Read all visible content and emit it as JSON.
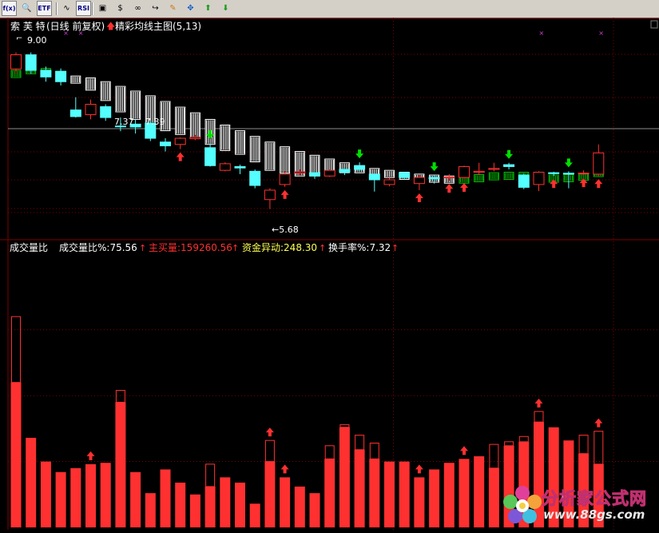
{
  "toolbar": {
    "buttons": [
      {
        "name": "formula-icon",
        "glyph": "f(x)"
      },
      {
        "name": "search-icon",
        "glyph": "🔍"
      },
      {
        "name": "etf-button",
        "glyph": "ETF"
      },
      {
        "name": "indicator-chart-icon",
        "glyph": "∿"
      },
      {
        "name": "rsi-button",
        "glyph": "RSI"
      },
      {
        "name": "picture-icon",
        "glyph": "▣"
      },
      {
        "name": "dollar-icon",
        "glyph": "$"
      },
      {
        "name": "link-icon",
        "glyph": "∞"
      },
      {
        "name": "export-icon",
        "glyph": "↪"
      },
      {
        "name": "pencil-icon",
        "glyph": "✎"
      },
      {
        "name": "move-icon",
        "glyph": "✥"
      },
      {
        "name": "up-arrow-icon",
        "glyph": "⬆"
      },
      {
        "name": "down-arrow-icon",
        "glyph": "⬇"
      }
    ]
  },
  "main_panel": {
    "stock_name": "索 芙 特",
    "period": "(日线 前复权)",
    "indicator_name": "精彩均线主图(5,13)",
    "high_label": "9.00",
    "low_label": "←5.68",
    "mid_label_a": "7.37",
    "mid_label_b": "7.39"
  },
  "sub_panel": {
    "name": "成交量比",
    "ratio_label": "成交量比%:75.56",
    "buy_label": "主买量:159260.56",
    "fund_label": "资金异动:248.30",
    "turnover_label": "换手率%:7.32"
  },
  "watermark": {
    "text": "分析家公式网",
    "url": "www.88gs.com"
  },
  "colors": {
    "up": "#ff3030",
    "down": "#54ffff",
    "ma_up": "#00c000",
    "ma_down": "#ffffff",
    "buy_arrow": "#ff3030",
    "sell_arrow": "#00e000",
    "label_white": "#ffffff",
    "label_yellow": "#ffff54",
    "label_red": "#ff3030",
    "grid": "#7f0000"
  },
  "chart_data": [
    {
      "type": "candlestick",
      "title": "精彩均线主图(5,13)",
      "ylim": [
        5.3,
        9.4
      ],
      "candles": [
        {
          "o": 8.65,
          "c": 8.95,
          "h": 9.0,
          "l": 8.55
        },
        {
          "o": 8.95,
          "c": 8.62,
          "h": 9.0,
          "l": 8.55
        },
        {
          "o": 8.62,
          "c": 8.48,
          "h": 8.7,
          "l": 8.38
        },
        {
          "o": 8.6,
          "c": 8.38,
          "h": 8.66,
          "l": 8.3
        },
        {
          "o": 7.78,
          "c": 7.64,
          "h": 8.05,
          "l": 7.62
        },
        {
          "o": 7.68,
          "c": 7.9,
          "h": 8.0,
          "l": 7.58
        },
        {
          "o": 7.85,
          "c": 7.62,
          "h": 7.9,
          "l": 7.55
        },
        {
          "o": 7.44,
          "c": 7.43,
          "h": 7.62,
          "l": 7.33
        },
        {
          "o": 7.48,
          "c": 7.42,
          "h": 7.58,
          "l": 7.28
        },
        {
          "o": 7.5,
          "c": 7.18,
          "h": 7.55,
          "l": 7.12
        },
        {
          "o": 7.1,
          "c": 7.02,
          "h": 7.18,
          "l": 6.9
        },
        {
          "o": 7.05,
          "c": 7.18,
          "h": 7.2,
          "l": 6.95
        },
        {
          "o": 7.17,
          "c": 7.2,
          "h": 7.25,
          "l": 7.14
        },
        {
          "o": 6.98,
          "c": 6.6,
          "h": 7.08,
          "l": 6.58
        },
        {
          "o": 6.5,
          "c": 6.64,
          "h": 6.67,
          "l": 6.48
        },
        {
          "o": 6.58,
          "c": 6.55,
          "h": 6.62,
          "l": 6.42
        },
        {
          "o": 6.48,
          "c": 6.18,
          "h": 6.52,
          "l": 6.12
        },
        {
          "o": 5.88,
          "c": 6.08,
          "h": 6.12,
          "l": 5.68
        },
        {
          "o": 6.2,
          "c": 6.42,
          "h": 6.48,
          "l": 6.15
        },
        {
          "o": 6.44,
          "c": 6.47,
          "h": 6.52,
          "l": 6.38
        },
        {
          "o": 6.45,
          "c": 6.38,
          "h": 6.48,
          "l": 6.32
        },
        {
          "o": 6.38,
          "c": 6.5,
          "h": 6.52,
          "l": 6.36
        },
        {
          "o": 6.52,
          "c": 6.46,
          "h": 6.56,
          "l": 6.4
        },
        {
          "o": 6.6,
          "c": 6.52,
          "h": 6.67,
          "l": 6.48
        },
        {
          "o": 6.42,
          "c": 6.3,
          "h": 6.44,
          "l": 6.05
        },
        {
          "o": 6.2,
          "c": 6.3,
          "h": 6.34,
          "l": 6.16
        },
        {
          "o": 6.45,
          "c": 6.35,
          "h": 6.47,
          "l": 6.3
        },
        {
          "o": 6.22,
          "c": 6.35,
          "h": 6.4,
          "l": 6.08
        },
        {
          "o": 6.35,
          "c": 6.32,
          "h": 6.4,
          "l": 6.22
        },
        {
          "o": 6.34,
          "c": 6.36,
          "h": 6.42,
          "l": 6.28
        },
        {
          "o": 6.35,
          "c": 6.58,
          "h": 6.6,
          "l": 6.3
        },
        {
          "o": 6.46,
          "c": 6.48,
          "h": 6.66,
          "l": 6.4
        },
        {
          "o": 6.52,
          "c": 6.54,
          "h": 6.66,
          "l": 6.48
        },
        {
          "o": 6.62,
          "c": 6.58,
          "h": 6.66,
          "l": 6.52
        },
        {
          "o": 6.4,
          "c": 6.14,
          "h": 6.44,
          "l": 6.1
        },
        {
          "o": 6.2,
          "c": 6.46,
          "h": 6.48,
          "l": 6.06
        },
        {
          "o": 6.45,
          "c": 6.43,
          "h": 6.47,
          "l": 6.38
        },
        {
          "o": 6.44,
          "c": 6.42,
          "h": 6.48,
          "l": 6.12
        },
        {
          "o": 6.44,
          "c": 6.44,
          "h": 6.5,
          "l": 6.4
        },
        {
          "o": 6.42,
          "c": 6.87,
          "h": 7.05,
          "l": 6.38
        }
      ],
      "ma5": [
        8.62,
        8.7,
        8.66,
        8.6,
        8.44,
        8.2,
        7.98,
        7.74,
        7.58,
        7.5,
        7.34,
        7.26,
        7.2,
        7.05,
        6.92,
        6.84,
        6.68,
        6.5,
        6.44,
        6.38,
        6.38,
        6.43,
        6.45,
        6.46,
        6.45,
        6.4,
        6.39,
        6.32,
        6.32,
        6.34,
        6.38,
        6.41,
        6.45,
        6.46,
        6.46,
        6.44,
        6.4,
        6.41,
        6.44,
        6.52
      ],
      "ma13": [
        8.5,
        8.55,
        8.55,
        8.54,
        8.5,
        8.46,
        8.38,
        8.28,
        8.18,
        8.08,
        7.96,
        7.84,
        7.72,
        7.58,
        7.46,
        7.34,
        7.22,
        7.1,
        7.0,
        6.9,
        6.82,
        6.74,
        6.66,
        6.6,
        6.54,
        6.5,
        6.46,
        6.42,
        6.4,
        6.38,
        6.37,
        6.37,
        6.38,
        6.39,
        6.39,
        6.39,
        6.39,
        6.4,
        6.41,
        6.44
      ],
      "buy_signals": [
        11,
        18,
        27,
        29,
        30,
        36,
        38,
        39
      ],
      "sell_signals": [
        13,
        23,
        28,
        33,
        37
      ]
    },
    {
      "type": "bar",
      "title": "成交量比",
      "ylim": [
        0,
        205
      ],
      "volume": [
        110,
        68,
        50,
        42,
        45,
        48,
        49,
        95,
        42,
        26,
        44,
        34,
        25,
        31,
        38,
        34,
        18,
        50,
        38,
        31,
        26,
        52,
        76,
        59,
        52,
        50,
        50,
        38,
        44,
        49,
        52,
        54,
        45,
        62,
        65,
        80,
        76,
        66,
        56,
        48
      ],
      "volume_outline": [
        160,
        68,
        50,
        42,
        45,
        48,
        49,
        104,
        42,
        26,
        44,
        34,
        25,
        48,
        38,
        34,
        18,
        66,
        38,
        31,
        26,
        62,
        78,
        70,
        64,
        50,
        50,
        38,
        44,
        49,
        52,
        54,
        63,
        65,
        69,
        88,
        76,
        66,
        70,
        73
      ],
      "buy_volume": [
        93,
        55,
        40,
        50,
        48,
        48,
        72,
        32,
        30,
        40,
        27,
        27,
        14,
        26,
        35,
        22,
        5,
        41,
        26,
        23,
        17,
        50,
        68,
        30,
        41,
        28,
        28,
        17,
        14,
        29,
        23,
        27,
        13,
        28,
        92,
        34,
        20,
        48,
        8,
        130
      ],
      "buy_volume_outline": [
        93,
        55,
        40,
        50,
        48,
        48,
        72,
        32,
        30,
        40,
        27,
        27,
        14,
        26,
        35,
        22,
        5,
        41,
        26,
        23,
        17,
        50,
        68,
        30,
        41,
        28,
        28,
        17,
        14,
        29,
        23,
        27,
        13,
        28,
        120,
        34,
        20,
        48,
        8,
        130
      ],
      "signal_bars": [
        5,
        17,
        18,
        27,
        30,
        35,
        39
      ]
    }
  ]
}
